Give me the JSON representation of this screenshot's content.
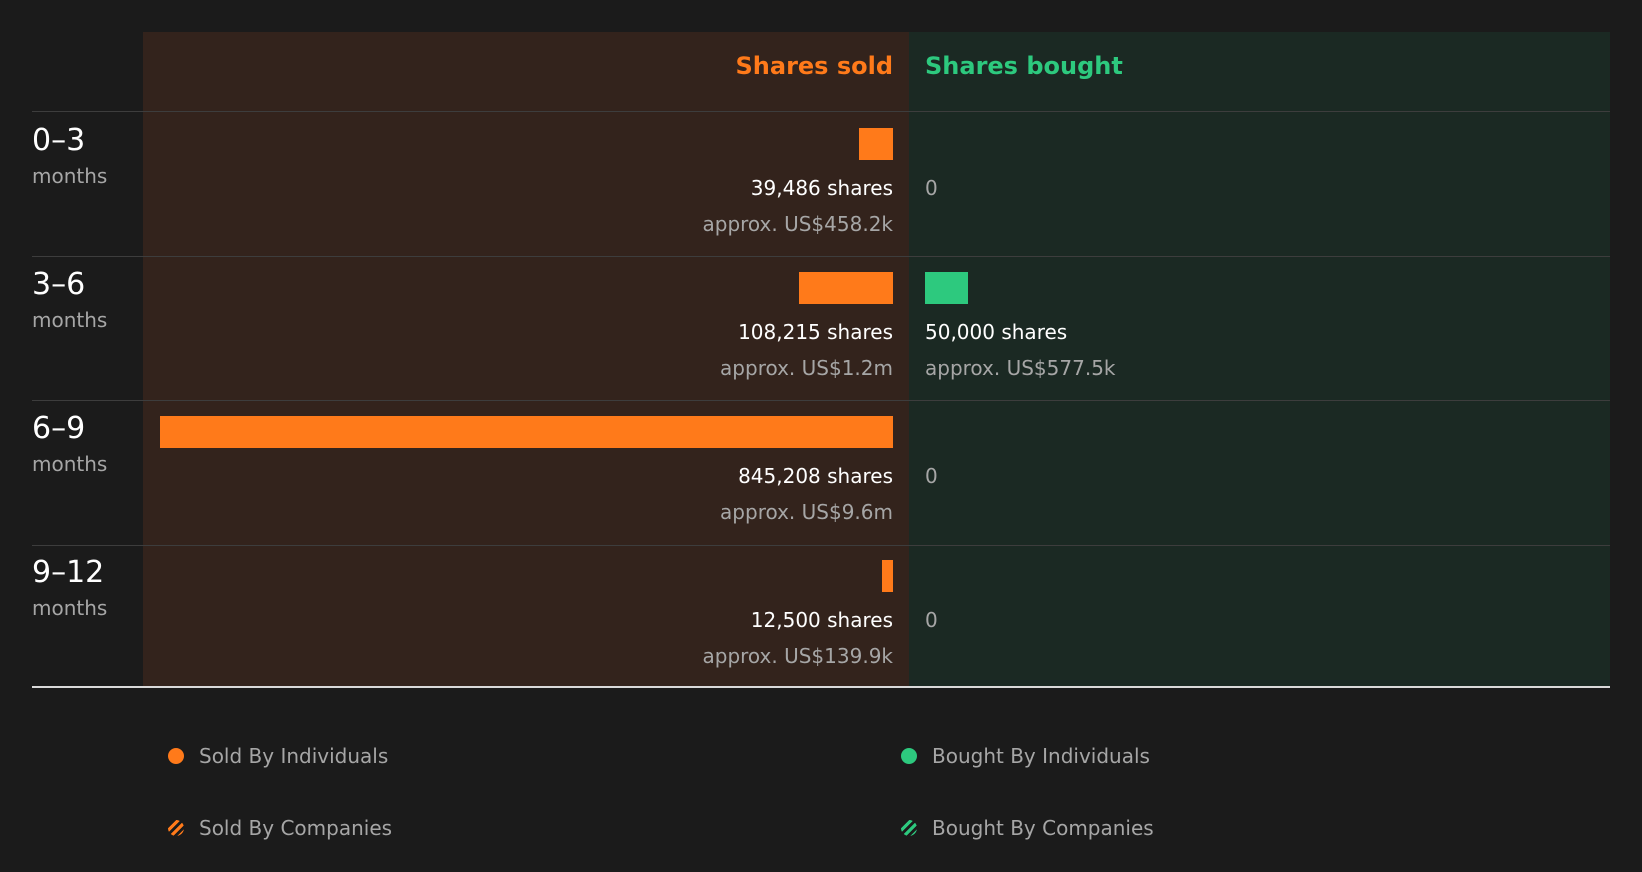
{
  "header": {
    "sold_label": "Shares sold",
    "bought_label": "Shares bought"
  },
  "rows": [
    {
      "range": "0–3",
      "unit": "months",
      "sold_shares": "39,486 shares",
      "sold_value": "approx. US$458.2k",
      "bought_shares": "0",
      "bought_value": ""
    },
    {
      "range": "3–6",
      "unit": "months",
      "sold_shares": "108,215 shares",
      "sold_value": "approx. US$1.2m",
      "bought_shares": "50,000 shares",
      "bought_value": "approx. US$577.5k"
    },
    {
      "range": "6–9",
      "unit": "months",
      "sold_shares": "845,208 shares",
      "sold_value": "approx. US$9.6m",
      "bought_shares": "0",
      "bought_value": ""
    },
    {
      "range": "9–12",
      "unit": "months",
      "sold_shares": "12,500 shares",
      "sold_value": "approx. US$139.9k",
      "bought_shares": "0",
      "bought_value": ""
    }
  ],
  "legend": [
    {
      "label": "Sold By Individuals"
    },
    {
      "label": "Bought By Individuals"
    },
    {
      "label": "Sold By Companies"
    },
    {
      "label": "Bought By Companies"
    }
  ],
  "colors": {
    "sold": "#ff7a1a",
    "bought": "#2dc97e",
    "sold_panel": "#33231c",
    "bought_panel": "#1b2923",
    "background": "#1b1b1b"
  },
  "chart_data": {
    "type": "bar",
    "categories": [
      "0–3",
      "3–6",
      "6–9",
      "9–12"
    ],
    "series": [
      {
        "name": "Shares sold",
        "values": [
          39486,
          108215,
          845208,
          12500
        ]
      },
      {
        "name": "Shares bought",
        "values": [
          0,
          50000,
          0,
          0
        ]
      }
    ]
  }
}
